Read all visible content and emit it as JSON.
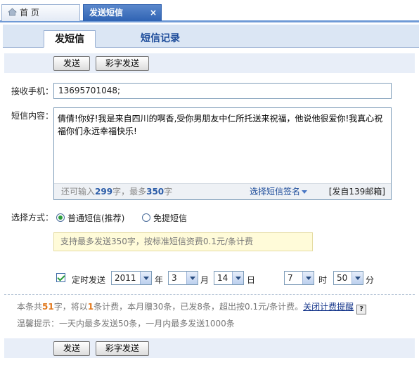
{
  "window_tabs": {
    "home_label": "首 页",
    "sms_label": "发送短信",
    "close_glyph": "×"
  },
  "inner_tabs": {
    "send_sms": "发短信",
    "records": "短信记录"
  },
  "toolbar": {
    "send_label": "发送",
    "color_send_label": "彩字发送"
  },
  "form": {
    "phone_label": "接收手机：",
    "phone_value": "13695701048;",
    "content_label": "短信内容：",
    "content_value": "倩倩!你好!我是来自四川的啊香,受你男朋友中仁所托送来祝福，他说他很爱你!我真心祝福你们永远幸福快乐!",
    "remain_prefix": "还可输入",
    "remain_count": "299",
    "remain_mid": "字，最多",
    "remain_max": "350",
    "remain_suffix": "字",
    "signature_label": "选择短信签名",
    "from_label": "[发自139邮箱]",
    "method_label": "选择方式：",
    "method_normal": "普通短信(推荐)",
    "method_free": "免提短信",
    "tip": "支持最多发送350字，按标准短信资费0.1元/条计费",
    "schedule_label": "定时发送",
    "year_value": "2011",
    "year_unit": "年",
    "month_value": "3",
    "month_unit": "月",
    "day_value": "14",
    "day_unit": "日",
    "hour_value": "7",
    "hour_unit": "时",
    "minute_value": "50",
    "minute_unit": "分"
  },
  "billing": {
    "p1": "本条共",
    "chars": "51",
    "p2": "字，将以",
    "count": "1",
    "p3": "条计费，本月赠30条，已发8条，超出按0.1元/条计费。",
    "close_link": "关闭计费提醒",
    "help_glyph": "?"
  },
  "reminder": "温馨提示：一天内最多发送50条，一月内最多发送1000条",
  "colors": {
    "accent": "#2f63b3",
    "tip_bg": "#fffbd9",
    "orange": "#e2781c"
  }
}
